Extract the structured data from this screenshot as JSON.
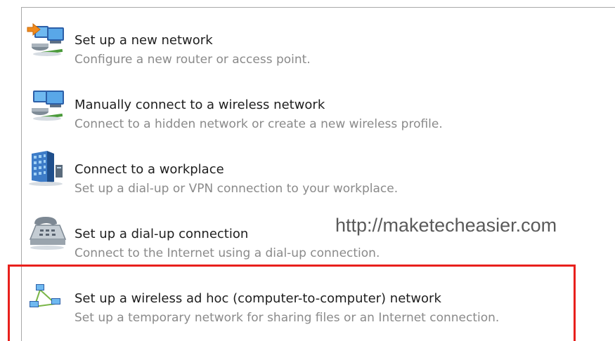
{
  "options": [
    {
      "title": "Set up a new network",
      "description": "Configure a new router or access point.",
      "icon": "new-network-icon"
    },
    {
      "title": "Manually connect to a wireless network",
      "description": "Connect to a hidden network or create a new wireless profile.",
      "icon": "wireless-network-icon"
    },
    {
      "title": "Connect to a workplace",
      "description": "Set up a dial-up or VPN connection to your workplace.",
      "icon": "workplace-icon"
    },
    {
      "title": "Set up a dial-up connection",
      "description": "Connect to the Internet using a dial-up connection.",
      "icon": "telephone-icon"
    },
    {
      "title": "Set up a wireless ad hoc (computer-to-computer) network",
      "description": "Set up a temporary network for sharing files or an Internet connection.",
      "icon": "ad-hoc-network-icon"
    }
  ],
  "watermark": "http://maketecheasier.com",
  "colors": {
    "highlight_border": "#e8201c",
    "title_text": "#1e1e1e",
    "description_text": "#8a8a8a",
    "panel_border": "#a9a9a9"
  }
}
